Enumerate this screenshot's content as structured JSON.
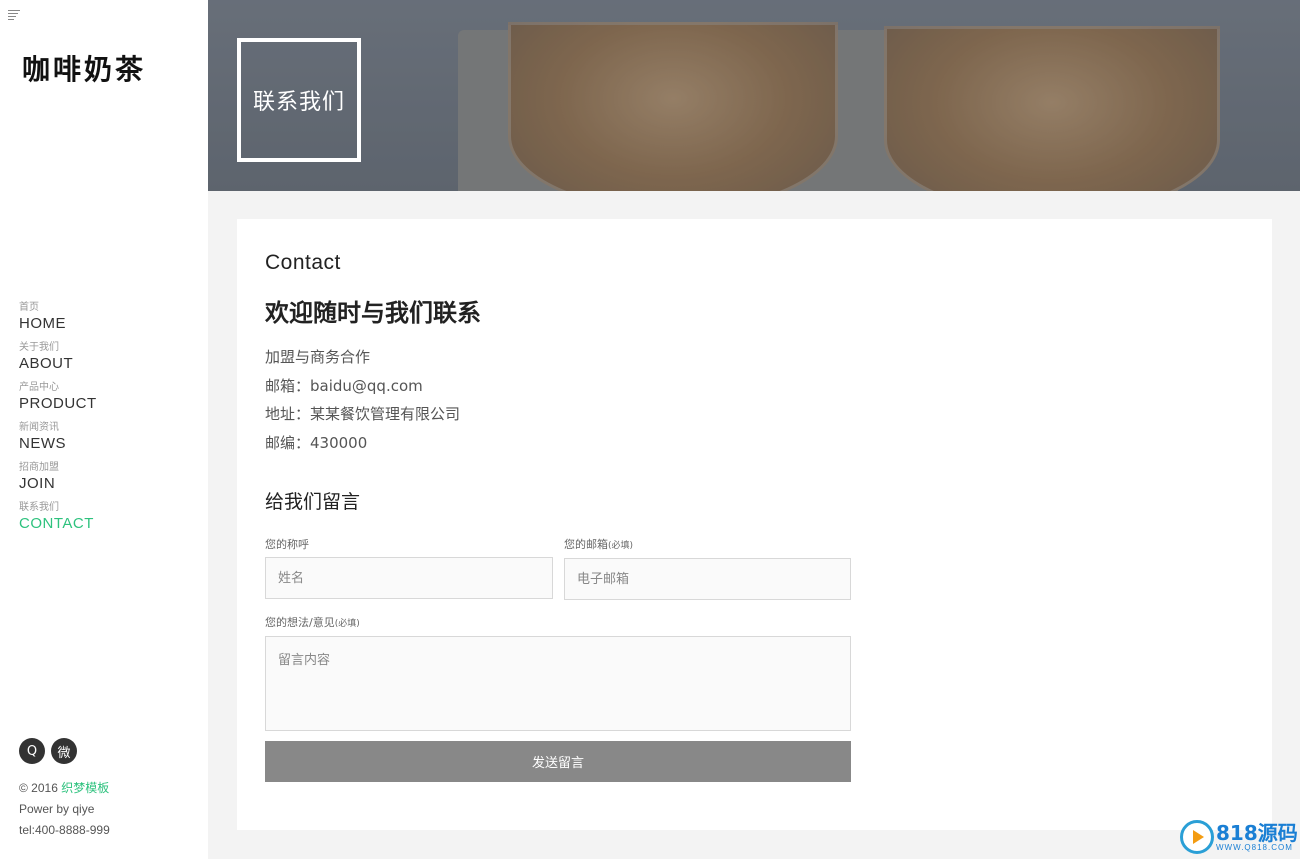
{
  "sidebar": {
    "logo": "咖啡奶茶",
    "nav": [
      {
        "cn": "首页",
        "en": "HOME"
      },
      {
        "cn": "关于我们",
        "en": "ABOUT"
      },
      {
        "cn": "产品中心",
        "en": "PRODUCT"
      },
      {
        "cn": "新闻资讯",
        "en": "NEWS"
      },
      {
        "cn": "招商加盟",
        "en": "JOIN"
      },
      {
        "cn": "联系我们",
        "en": "CONTACT"
      }
    ],
    "active_color": "#2ec27e",
    "social": {
      "qq_icon": "Q",
      "weibo_icon": "微"
    },
    "footer": {
      "copyright": "© 2016",
      "brand_link": "织梦模板",
      "power": "Power by qiye",
      "tel": "tel:400-8888-999"
    }
  },
  "banner": {
    "title": "联系我们"
  },
  "main": {
    "contact_label": "Contact",
    "heading": "欢迎随时与我们联系",
    "info": [
      "加盟与商务合作",
      "邮箱：baidu@qq.com",
      "地址：某某餐饮管理有限公司",
      "邮编：430000"
    ],
    "form": {
      "title": "给我们留言",
      "name_label": "您的称呼",
      "email_label": "您的邮箱",
      "required": "(必填)",
      "name_placeholder": "姓名",
      "email_placeholder": "电子邮箱",
      "message_label": "您的想法/意见",
      "message_placeholder": "留言内容",
      "submit": "发送留言"
    }
  },
  "watermark": {
    "big": "818源码",
    "small": "WWW.Q818.COM"
  }
}
